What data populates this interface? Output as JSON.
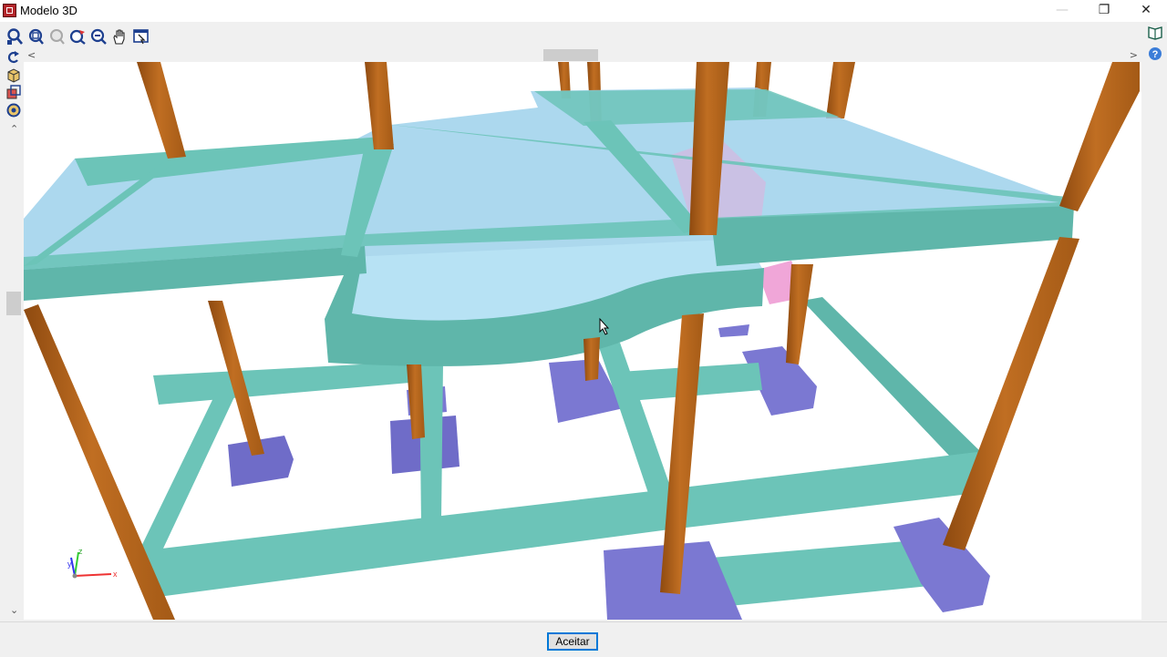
{
  "window": {
    "title": "Modelo 3D"
  },
  "toolbar": {
    "buttons": [
      {
        "name": "zoom-extents-icon"
      },
      {
        "name": "zoom-window-icon"
      },
      {
        "name": "zoom-disabled-icon"
      },
      {
        "name": "rotate-view-icon"
      },
      {
        "name": "zoom-out-icon"
      },
      {
        "name": "pan-hand-icon"
      },
      {
        "name": "view-select-icon"
      }
    ]
  },
  "side_tools": [
    {
      "name": "rotate-icon"
    },
    {
      "name": "cube-icon"
    },
    {
      "name": "layers-icon"
    },
    {
      "name": "eye-settings-icon"
    }
  ],
  "right_tools": [
    {
      "name": "book-icon"
    },
    {
      "name": "help-icon"
    }
  ],
  "axes": {
    "x": "x",
    "y": "y",
    "z": "z"
  },
  "colors": {
    "column": "#b4641e",
    "beam": "#6cc4b8",
    "slab": "#9ad0ea",
    "footing": "#7b78d2",
    "stair": "#f0a6d8"
  },
  "footer": {
    "accept_label": "Aceitar"
  }
}
